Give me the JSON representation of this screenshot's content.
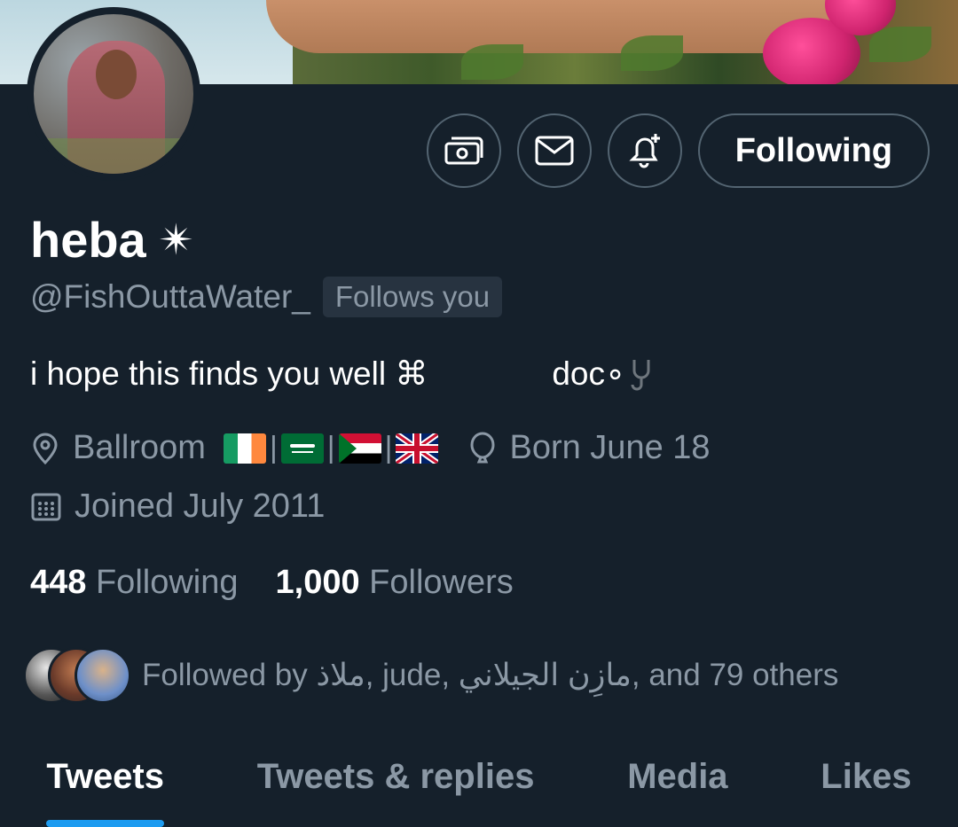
{
  "profile": {
    "display_name": "heba",
    "name_emoji": "✴",
    "handle": "@FishOuttaWater_",
    "follows_you_badge": "Follows you",
    "bio_text": "i hope this finds you well ⌘",
    "bio_tail": "doc∘",
    "location": "Ballroom",
    "location_flags": [
      "Ireland",
      "Saudi Arabia",
      "Sudan",
      "United Kingdom"
    ],
    "birthday": "Born June 18",
    "joined": "Joined July 2011"
  },
  "actions": {
    "follow_button_label": "Following"
  },
  "stats": {
    "following_count": "448",
    "following_label": "Following",
    "followers_count": "1,000",
    "followers_label": "Followers"
  },
  "followed_by": {
    "text": "Followed by ملاذ, jude, مازِن الجيلاني, and 79 others"
  },
  "tabs": [
    {
      "label": "Tweets",
      "active": true
    },
    {
      "label": "Tweets & replies",
      "active": false
    },
    {
      "label": "Media",
      "active": false
    },
    {
      "label": "Likes",
      "active": false
    }
  ],
  "colors": {
    "background": "#15202b",
    "muted_text": "#8b98a5",
    "accent": "#1d9bf0",
    "border": "#536471"
  }
}
